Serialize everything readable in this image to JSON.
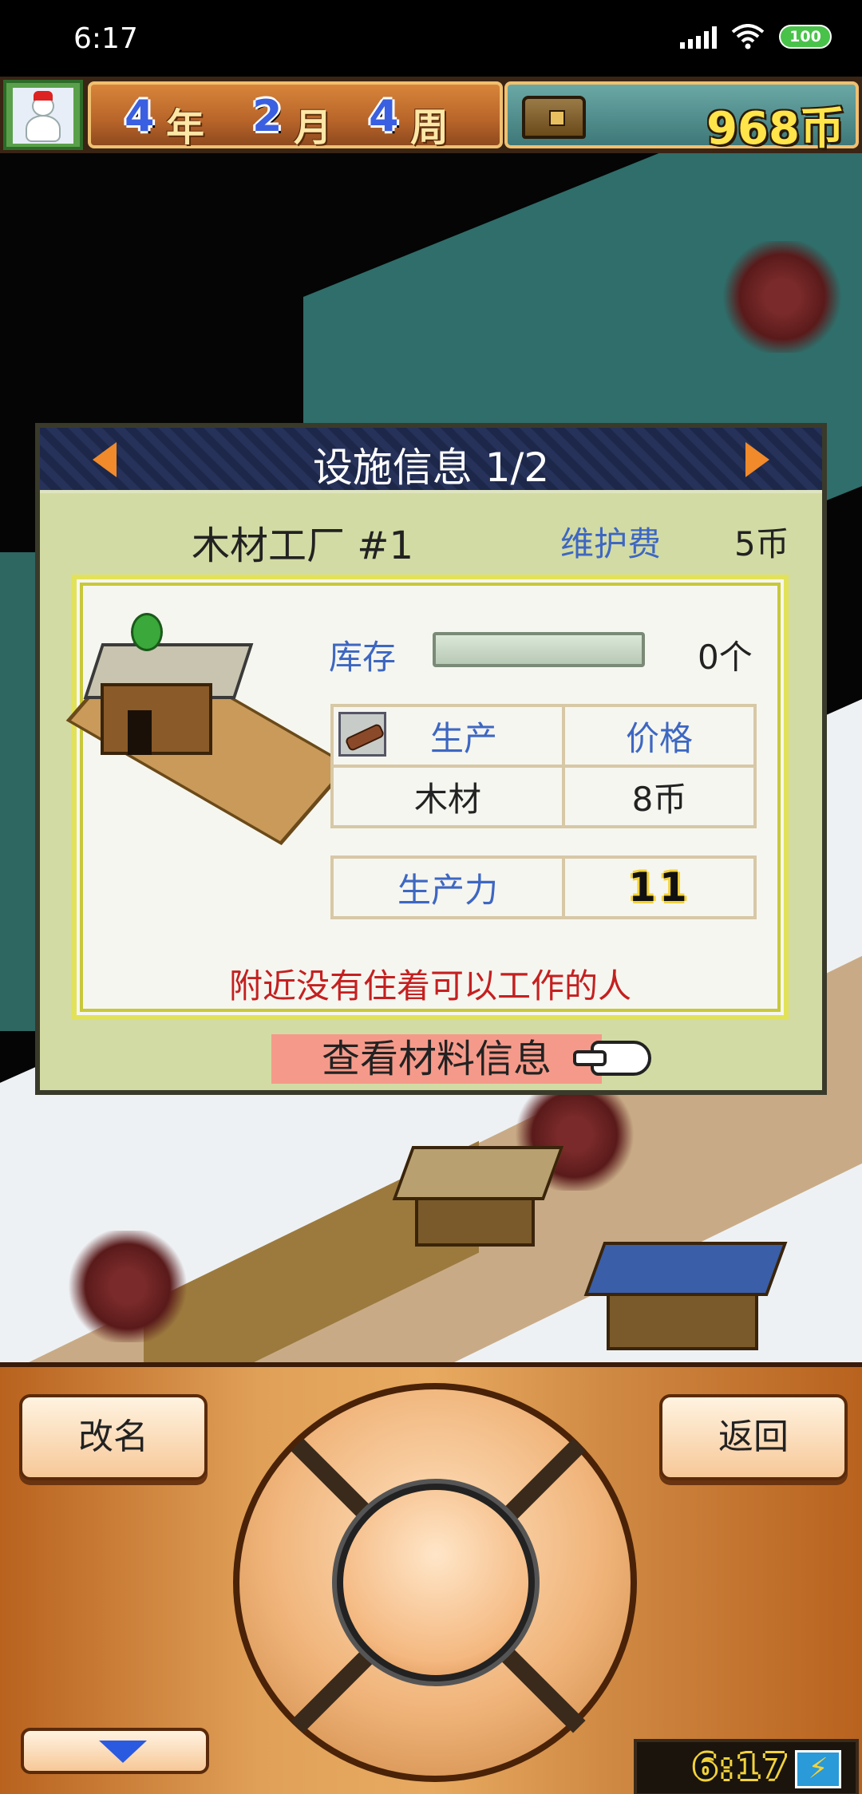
{
  "status_bar": {
    "time": "6:17",
    "battery": "100"
  },
  "top_bar": {
    "year_num": "4",
    "year_label": "年",
    "month_num": "2",
    "month_label": "月",
    "week_num": "4",
    "week_label": "周",
    "money": "968币"
  },
  "panel": {
    "title": "设施信息 1/2",
    "facility_name": "木材工厂 #1",
    "upkeep_label": "维护费",
    "upkeep_value": "5币",
    "stock_label": "库存",
    "stock_value": "0个",
    "stock_fill": 0,
    "table_header_product": "生产",
    "table_header_price": "价格",
    "product_name": "木材",
    "product_price": "8币",
    "productivity_label": "生产力",
    "productivity_value": "11",
    "warning": "附近没有住着可以工作的人",
    "materials_button": "查看材料信息"
  },
  "controls": {
    "rename": "改名",
    "back": "返回",
    "clock": "6:17"
  },
  "colors": {
    "label_blue": "#3d67c2",
    "warning_red": "#c42020",
    "panel_bg": "#d3dba4",
    "button_pink": "#f59a8a",
    "money_yellow": "#ffe44a"
  }
}
